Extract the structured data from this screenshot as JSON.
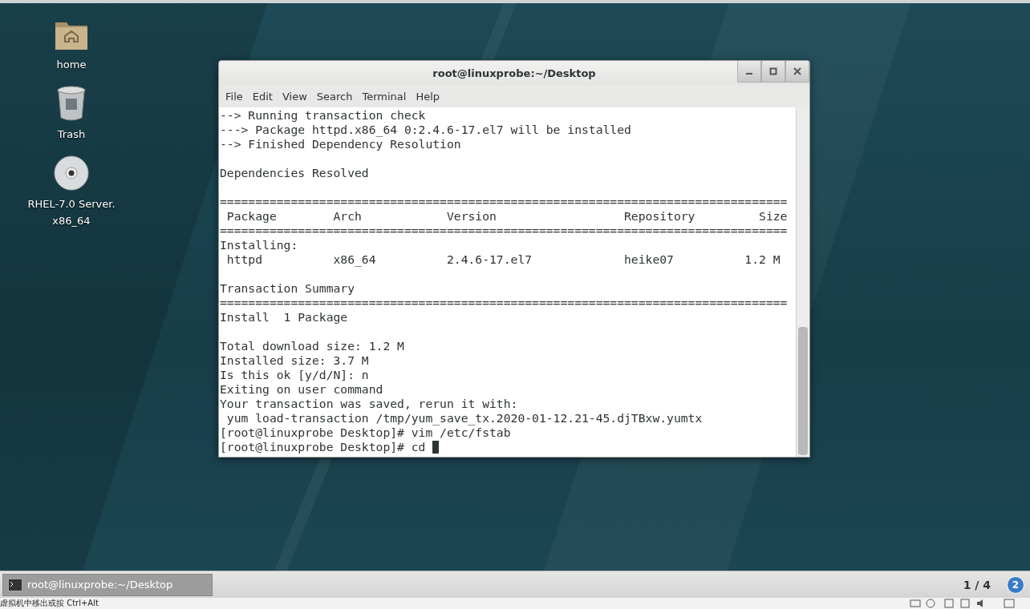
{
  "desktop_icons": [
    {
      "kind": "folder",
      "label": "home"
    },
    {
      "kind": "trash",
      "label": "Trash"
    },
    {
      "kind": "disc",
      "label": "RHEL-7.0 Server.\nx86_64"
    }
  ],
  "terminal": {
    "title": "root@linuxprobe:~/Desktop",
    "menu": [
      "File",
      "Edit",
      "View",
      "Search",
      "Terminal",
      "Help"
    ],
    "lines": [
      {
        "kind": "text",
        "text": "--> Running transaction check"
      },
      {
        "kind": "text",
        "text": "---> Package httpd.x86_64 0:2.4.6-17.el7 will be installed"
      },
      {
        "kind": "text",
        "text": "--> Finished Dependency Resolution"
      },
      {
        "kind": "blank"
      },
      {
        "kind": "text",
        "text": "Dependencies Resolved"
      },
      {
        "kind": "blank"
      },
      {
        "kind": "text",
        "text": "================================================================================"
      },
      {
        "kind": "text",
        "text": " Package        Arch            Version                  Repository         Size"
      },
      {
        "kind": "text",
        "text": "================================================================================"
      },
      {
        "kind": "text",
        "text": "Installing:"
      },
      {
        "kind": "text",
        "text": " httpd          x86_64          2.4.6-17.el7             heike07          1.2 M"
      },
      {
        "kind": "blank"
      },
      {
        "kind": "text",
        "text": "Transaction Summary"
      },
      {
        "kind": "text",
        "text": "================================================================================"
      },
      {
        "kind": "text",
        "text": "Install  1 Package"
      },
      {
        "kind": "blank"
      },
      {
        "kind": "text",
        "text": "Total download size: 1.2 M"
      },
      {
        "kind": "text",
        "text": "Installed size: 3.7 M"
      },
      {
        "kind": "text",
        "text": "Is this ok [y/d/N]: n"
      },
      {
        "kind": "text",
        "text": "Exiting on user command"
      },
      {
        "kind": "text",
        "text": "Your transaction was saved, rerun it with:"
      },
      {
        "kind": "text",
        "text": " yum load-transaction /tmp/yum_save_tx.2020-01-12.21-45.djTBxw.yumtx"
      },
      {
        "kind": "text",
        "text": "[root@linuxprobe Desktop]# vim /etc/fstab"
      },
      {
        "kind": "prompt",
        "text": "[root@linuxprobe Desktop]# cd"
      }
    ]
  },
  "taskbar": {
    "tasks": [
      {
        "label": "root@linuxprobe:~/Desktop",
        "selected": true
      }
    ],
    "workspace": "1 / 4",
    "badge": "2"
  },
  "vm_status": {
    "hint": "虚拟机中移出或按 Ctrl+Alt"
  }
}
